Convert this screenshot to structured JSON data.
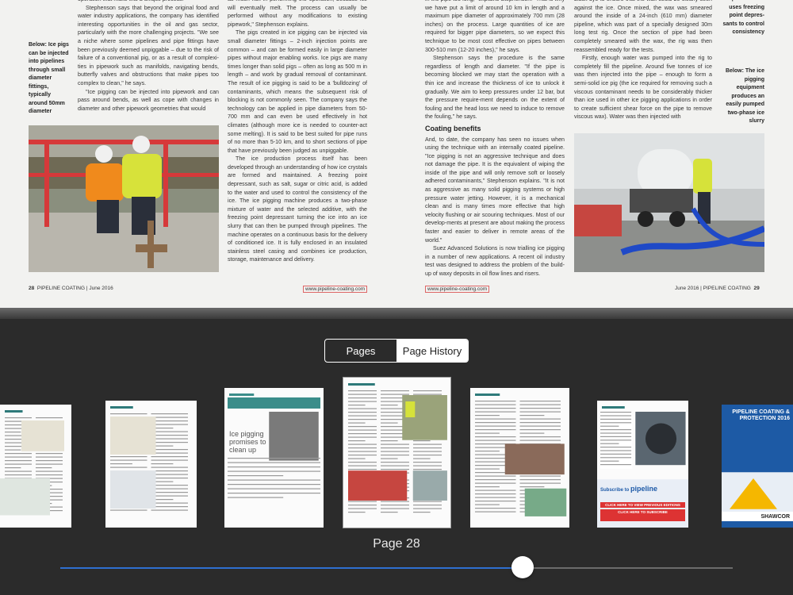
{
  "spread": {
    "left_folio": "28",
    "left_pub": "PIPELINE COATING | June 2016",
    "right_folio": "29",
    "right_pub": "June 2016 | PIPELINE COATING",
    "url": "www.pipeline-coating.com",
    "left_caption": "Below: Ice pigs can be injected into pipelines through small diameter fittings, typically around 50mm diameter",
    "right_caption_top": "process and uses freezing point depres-sants to control consistency",
    "right_caption_bottom": "Below: The ice pigging equipment produces an easily pumped two-phase ice slurry",
    "col1": [
      "operation that make this a unique process.\"",
      "Stephenson says that beyond the original food and water industry applications, the company has identified interesting opportunities in the oil and gas sector, particularly with the more challenging projects. \"We see a niche where some pipelines and pipe fittings have been previously deemed unpiggable – due to the risk of failure of a conventional pig, or as a result of complexi-ties in pipework such as manifolds, navigating bends, butterfly valves and obstructions that make pipes too complex to clean,\" he says.",
      "\"Ice pigging can be injected into pipework and can pass around bends, as well as cope with changes in diameter and other pipework geometries that would"
    ],
    "col2": [
      "as much risk in performing the operation, because ice will eventually melt. The process can usually be performed without any modifications to existing pipework,\" Stephenson explains.",
      "The pigs created in ice pigging can be injected via small diameter fittings – 2-inch injection points are common – and can be formed easily in large diameter pipes without major enabling works. Ice pigs are many times longer than solid pigs – often as long as 500 m in length – and work by gradual removal of contaminant. The result of ice pigging is said to be a 'bulldozing' of contaminants, which means the subsequent risk of blocking is not commonly seen. The company says the technology can be applied in pipe diameters from 50-700 mm and can even be used effectively in hot climates (although more ice is needed to counter-act some melting). It is said to be best suited for pipe runs of no more than 5-10 km, and to short sections of pipe that have previously been judged as unpiggable.",
      "The ice production process itself has been developed through an understanding of how ice crystals are formed and maintained. A freezing point depressant, such as salt, sugar or citric acid, is added to the water and used to control the consistency of the ice. The ice pigging machine produces a two-phase mixture of water and the selected additive, with the freezing point depressant turning the ice into an ice slurry that can then be pumped through pipelines. The machine operates on a continuous basis for the delivery of conditioned ice. It is fully enclosed in an insulated stainless steel casing and combines ice production, storage, maintenance and delivery."
    ],
    "col3_a": [
      "in the pipe too long,\" explains Stephenson. \"That is why we have put a limit of around 10 km in length and a maximum pipe diameter of approximately 700 mm (28 inches) on the process. Large quantities of ice are required for bigger pipe diameters, so we expect this technique to be most cost effective on pipes between 300-510 mm (12-20 inches),\" he says.",
      "Stephenson says the procedure is the same regardless of length and diameter. \"If the pipe is becoming blocked we may start the operation with a thin ice and increase the thickness of ice to unlock it gradually. We aim to keep pressures under 12 bar, but the pressure require-ment depends on the extent of fouling and the head loss we need to induce to remove the fouling,\" he says."
    ],
    "col3_heading": "Coating benefits",
    "col3_b": [
      "And, to date, the company has seen no issues when using the technique with an internally coated pipeline. \"Ice pigging is not an aggressive technique and does not damage the pipe. It is the equivalent of wiping the inside of the pipe and will only remove soft or loosely adhered contaminants,\" Stephenson explains. \"It is not as aggressive as many solid pigging systems or high pressure water jetting. However, it is a mechanical clean and is many times more effective that high velocity flushing or air scouring techniques. Most of our develop-ments at present are about making the process faster and easier to deliver in remote areas of the world.\"",
      "Suez Advanced Solutions is now trialling ice pigging in a number of new applications. A recent oil industry test was designed to address the problem of the build-up of waxy deposits in oil flow lines and risers."
    ],
    "col4": [
      "black dye to ensure that the wax could be clearly seen against the ice. Once mixed, the wax was smeared around the inside of a 24-inch (610 mm) diameter pipeline, which was part of a specially designed 30m long test rig. Once the section of pipe had been completely smeared with the wax, the rig was then reassembled ready for the tests.",
      "Firstly, enough water was pumped into the rig to completely fill the pipeline. Around five tonnes of ice was then injected into the pipe – enough to form a semi-solid ice pig (the ice required for removing such a viscous contaminant needs to be considerably thicker than ice used in other ice pigging applications in order to create sufficient shear force on the pipe to remove viscous wax). Water was then injected with"
    ]
  },
  "segmented": {
    "pages_label": "Pages",
    "history_label": "Page History",
    "selected": "history"
  },
  "thumbnails": [
    {
      "id": "t1",
      "title": "",
      "colors": [
        "#2e7a7a",
        "#e97a3a"
      ]
    },
    {
      "id": "t2",
      "title": "",
      "colors": [
        "#2e7a7a",
        "#d26b3a"
      ]
    },
    {
      "id": "t3",
      "title": "Ice pigging promises to clean up",
      "colors": [
        "#3a8d8a"
      ]
    },
    {
      "id": "t4",
      "title": "",
      "colors": [
        "#2e7a7a",
        "#e0433a"
      ],
      "selected": true
    },
    {
      "id": "t5",
      "title": "",
      "colors": [
        "#2e7a7a"
      ]
    },
    {
      "id": "t6",
      "title": "",
      "colors": [
        "#2e7a7a",
        "#1e5aa8"
      ],
      "ad": "pipeline",
      "ad_text": "Subscribe to",
      "ad_btn": "CLICK HERE TO SUBSCRIBE",
      "ad_btn2": "CLICK HERE TO VIEW PREVIOUS EDITIONS"
    },
    {
      "id": "t7",
      "title": "PIPELINE COATING & PROTECTION 2016",
      "colors": [
        "#1d5aa5",
        "#f5b700"
      ],
      "brand": "SHAWCOR"
    }
  ],
  "current_page_label": "Page 28",
  "slider": {
    "value": 0.688
  },
  "colors": {
    "accent": "#2f6fd0",
    "background": "#2b2b2b"
  }
}
